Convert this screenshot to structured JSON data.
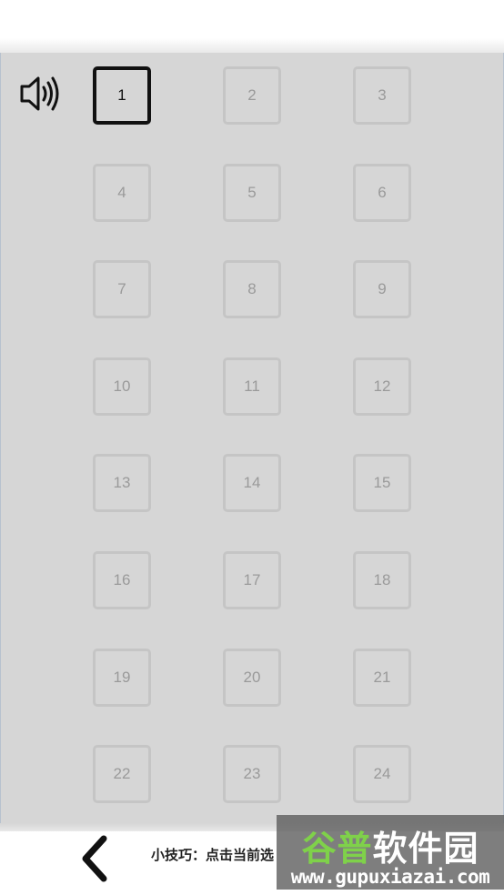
{
  "levels": {
    "current": 1,
    "items": [
      "1",
      "2",
      "3",
      "4",
      "5",
      "6",
      "7",
      "8",
      "9",
      "10",
      "11",
      "12",
      "13",
      "14",
      "15",
      "16",
      "17",
      "18",
      "19",
      "20",
      "21",
      "22",
      "23",
      "24"
    ]
  },
  "sound": {
    "icon": "speaker-on-icon"
  },
  "back": {
    "icon": "chevron-left-icon"
  },
  "tip": {
    "text": "小技巧：点击当前选"
  },
  "watermark": {
    "title_green": "谷普",
    "title_white": "软件园",
    "url": "www.gupuxiazai.com"
  },
  "colors": {
    "board": "#d6d6d6",
    "locked_border": "#c5c5c5",
    "locked_text": "#9a9a9a",
    "current_border": "#111111"
  }
}
